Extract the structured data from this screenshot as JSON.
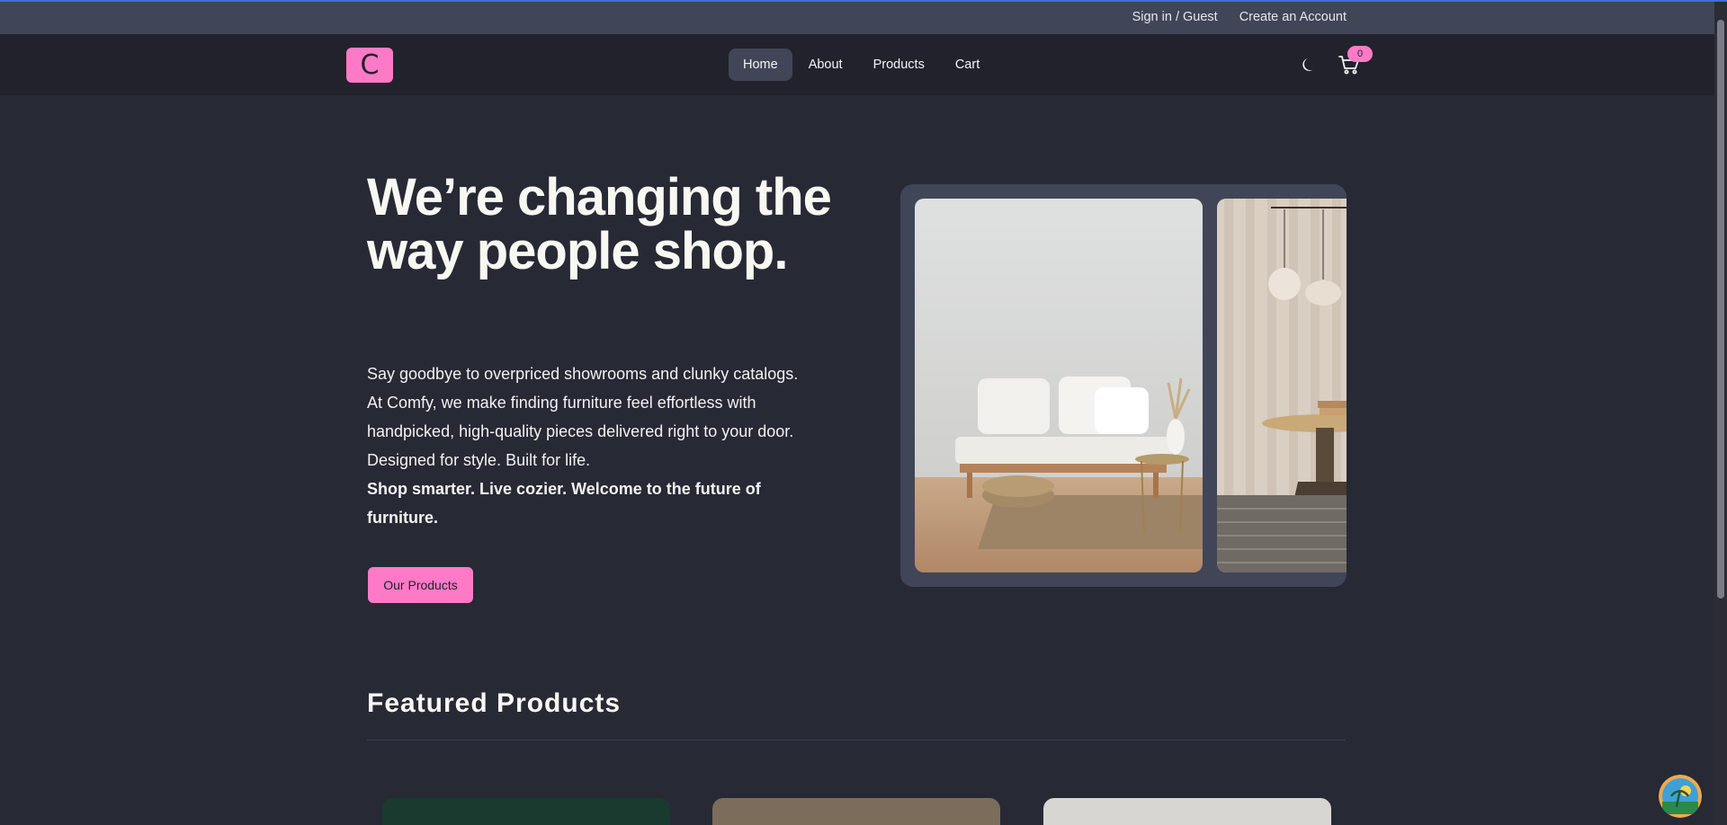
{
  "topbar": {
    "sign_in": "Sign in / Guest",
    "create_account": "Create an Account"
  },
  "navbar": {
    "logo_letter": "C",
    "links": [
      "Home",
      "About",
      "Products",
      "Cart"
    ],
    "active_link": "Home",
    "cart_count": "0",
    "icons": {
      "theme": "moon-icon",
      "cart": "cart-icon"
    }
  },
  "hero": {
    "title": "We’re changing the way people shop.",
    "paragraph": "Say goodbye to overpriced showrooms and clunky catalogs. At Comfy, we make finding furniture feel effortless with handpicked, high-quality pieces delivered right to your door. Designed for style. Built for life.",
    "tagline": "Shop smarter. Live cozier. Welcome to the future of furniture.",
    "cta_label": "Our Products"
  },
  "featured": {
    "title": "Featured Products"
  },
  "colors": {
    "accent": "#ff7ac6",
    "background": "#272935",
    "navbar": "#21222c",
    "topbar": "#414558"
  }
}
